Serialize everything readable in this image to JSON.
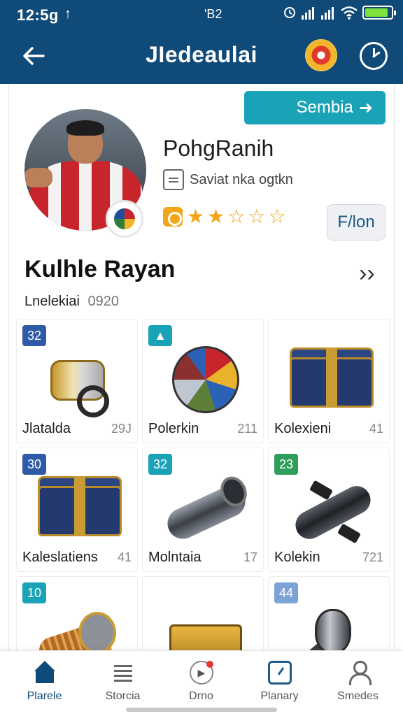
{
  "status_bar": {
    "time": "12:5g",
    "center": "'B2",
    "battery_level": 0.9
  },
  "app_bar": {
    "title": "JIedeaulai"
  },
  "share_button": {
    "label": "Sembia"
  },
  "profile": {
    "name": "PohgRanih",
    "subtitle": "Saviat nka ogtkn",
    "rating": 2,
    "rating_max": 5,
    "follow_label": "F/lon"
  },
  "section": {
    "title": "Kulhle Rayan",
    "sub_label": "Lnelekiai",
    "sub_count": "0920"
  },
  "items": [
    {
      "badge": "32",
      "badge_color": "#2f5aa8",
      "label": "Jlatalda",
      "count": "29J"
    },
    {
      "badge": "▲",
      "badge_color": "#1aa3b7",
      "label": "Polerkin",
      "count": "211"
    },
    {
      "badge": "",
      "badge_color": "",
      "label": "Kolexieni",
      "count": "41"
    },
    {
      "badge": "30",
      "badge_color": "#2f5aa8",
      "label": "Kalеslаtiens",
      "count": "41"
    },
    {
      "badge": "32",
      "badge_color": "#1aa3b7",
      "label": "Molntaia",
      "count": "17"
    },
    {
      "badge": "23",
      "badge_color": "#2f9e5a",
      "label": "Kolekin",
      "count": "721"
    },
    {
      "badge": "10",
      "badge_color": "#1aa3b7",
      "label": "",
      "count": ""
    },
    {
      "badge": "",
      "badge_color": "",
      "label": "",
      "count": ""
    },
    {
      "badge": "44",
      "badge_color": "#7da3d6",
      "label": "",
      "count": ""
    }
  ],
  "bottom_nav": [
    {
      "label": "Plarele",
      "icon": "home-icon",
      "active": true
    },
    {
      "label": "Storcia",
      "icon": "list-icon",
      "active": false
    },
    {
      "label": "Drno",
      "icon": "disc-icon",
      "active": false
    },
    {
      "label": "Planary",
      "icon": "gauge-icon",
      "active": false
    },
    {
      "label": "Smedes",
      "icon": "person-icon",
      "active": false
    }
  ],
  "colors": {
    "primary": "#0f4a78",
    "accent": "#1aa3b7",
    "star": "#f2a516"
  }
}
